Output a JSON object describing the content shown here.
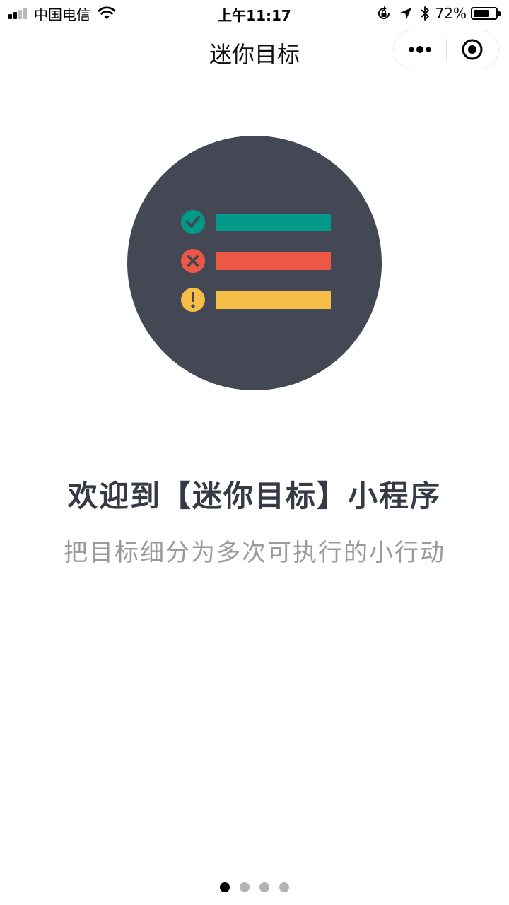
{
  "status_bar": {
    "carrier": "中国电信",
    "time": "上午11:17",
    "battery_percent": "72%",
    "battery_level": 0.72,
    "signal_bars_filled": 2,
    "signal_bars_total": 4,
    "icons": [
      "signal-icon",
      "wifi-icon",
      "orientation-lock-icon",
      "location-arrow-icon",
      "bluetooth-icon",
      "battery-icon"
    ]
  },
  "nav": {
    "title": "迷你目标",
    "capsule": {
      "more_icon": "more-dots-icon",
      "close_icon": "circle-target-icon"
    }
  },
  "hero": {
    "background_color": "#434854",
    "rows": [
      {
        "status_icon": "check-circle-icon",
        "color": "#00998a"
      },
      {
        "status_icon": "x-circle-icon",
        "color": "#ec5845"
      },
      {
        "status_icon": "exclamation-circle-icon",
        "color": "#f6bd47"
      }
    ]
  },
  "welcome": {
    "title": "欢迎到【迷你目标】小程序",
    "subtitle": "把目标细分为多次可执行的小行动"
  },
  "pager": {
    "total": 4,
    "active_index": 0
  }
}
